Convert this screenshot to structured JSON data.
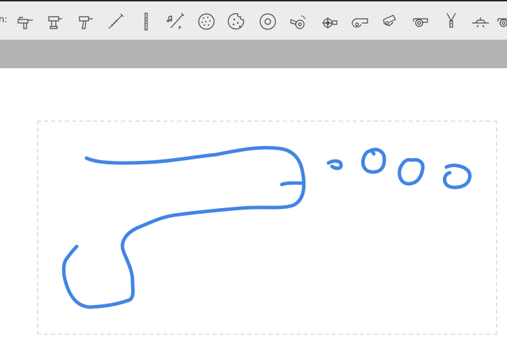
{
  "suggestions_bar": {
    "prefix": "n:",
    "icons": [
      "hand-drill-icon",
      "cordless-drill-icon",
      "power-drill-icon",
      "flute-icon",
      "recorder-icon",
      "music-flute-icon",
      "round-cracker-icon",
      "cookie-icon",
      "disc-icon",
      "whistle-icon",
      "cannon-target-icon",
      "cannon-icon",
      "referee-whistle-icon",
      "coach-whistle-icon",
      "lanyard-whistle-icon",
      "airplane-icon",
      "whistle-partial-icon"
    ]
  },
  "canvas": {
    "stroke_color": "#4285e4",
    "frame_color": "#e3e3e3"
  }
}
